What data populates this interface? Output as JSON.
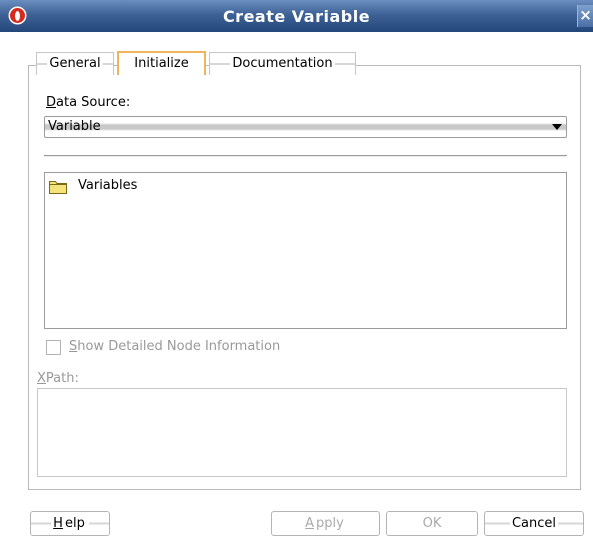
{
  "window": {
    "title": "Create Variable",
    "close_glyph": "×",
    "app_icon": "oracle-logo-icon"
  },
  "tabs": [
    {
      "label": "General",
      "selected": false
    },
    {
      "label": "Initialize",
      "selected": true
    },
    {
      "label": "Documentation",
      "selected": false
    }
  ],
  "data_source": {
    "label_mnemonic": "D",
    "label_rest": "ata Source:",
    "value": "Variable"
  },
  "tree": {
    "items": [
      {
        "label": "Variables",
        "icon": "folder-icon"
      }
    ]
  },
  "show_details": {
    "mnemonic": "S",
    "rest": "how Detailed Node Information",
    "checked": false,
    "enabled": false
  },
  "xpath": {
    "mnemonic": "X",
    "rest": "Path:",
    "value": ""
  },
  "buttons": {
    "help_mnemonic": "H",
    "help_rest": "elp",
    "apply_mnemonic": "A",
    "apply_rest": "pply",
    "ok": "OK",
    "cancel": "Cancel"
  },
  "colors": {
    "titlebar": "#3e6296",
    "selected_tab_border": "#f0b45a",
    "disabled_text": "#aaaaaa"
  }
}
